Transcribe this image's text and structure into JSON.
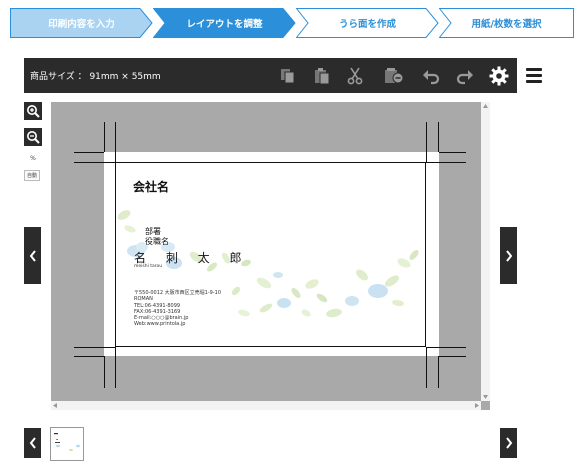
{
  "steps": [
    {
      "label": "印刷内容を入力",
      "state": "done"
    },
    {
      "label": "レイアウトを調整",
      "state": "active"
    },
    {
      "label": "うら面を作成",
      "state": "todo"
    },
    {
      "label": "用紙/枚数を選択",
      "state": "todo"
    }
  ],
  "colors": {
    "step_active": "#2c8fd9",
    "step_done": "#a9d3f0",
    "step_border": "#2c8fd9",
    "toolbar": "#2b2b2b",
    "canvas": "#a9a9a9"
  },
  "toolbar": {
    "product_size": "商品サイズ ： 91mm × 55mm",
    "icons": [
      "copy-icon",
      "paste-icon",
      "cut-icon",
      "delete-icon",
      "undo-icon",
      "redo-icon",
      "settings-icon"
    ]
  },
  "zoom": {
    "percent_label": "%",
    "auto_label": "自動"
  },
  "card": {
    "company": "会社名",
    "department": "部署",
    "title": "役職名",
    "name": "名 刺 太 郎",
    "name_roman": "meishi tarou",
    "address_lines": [
      "〒550-0012 大阪市西区立売堀1-9-10",
      "ROMAN",
      "TEL:06-4391-8099",
      "FAX:06-4391-3169",
      "E-mail:○○○@brain.jp",
      "Web:www.printola.jp"
    ]
  }
}
